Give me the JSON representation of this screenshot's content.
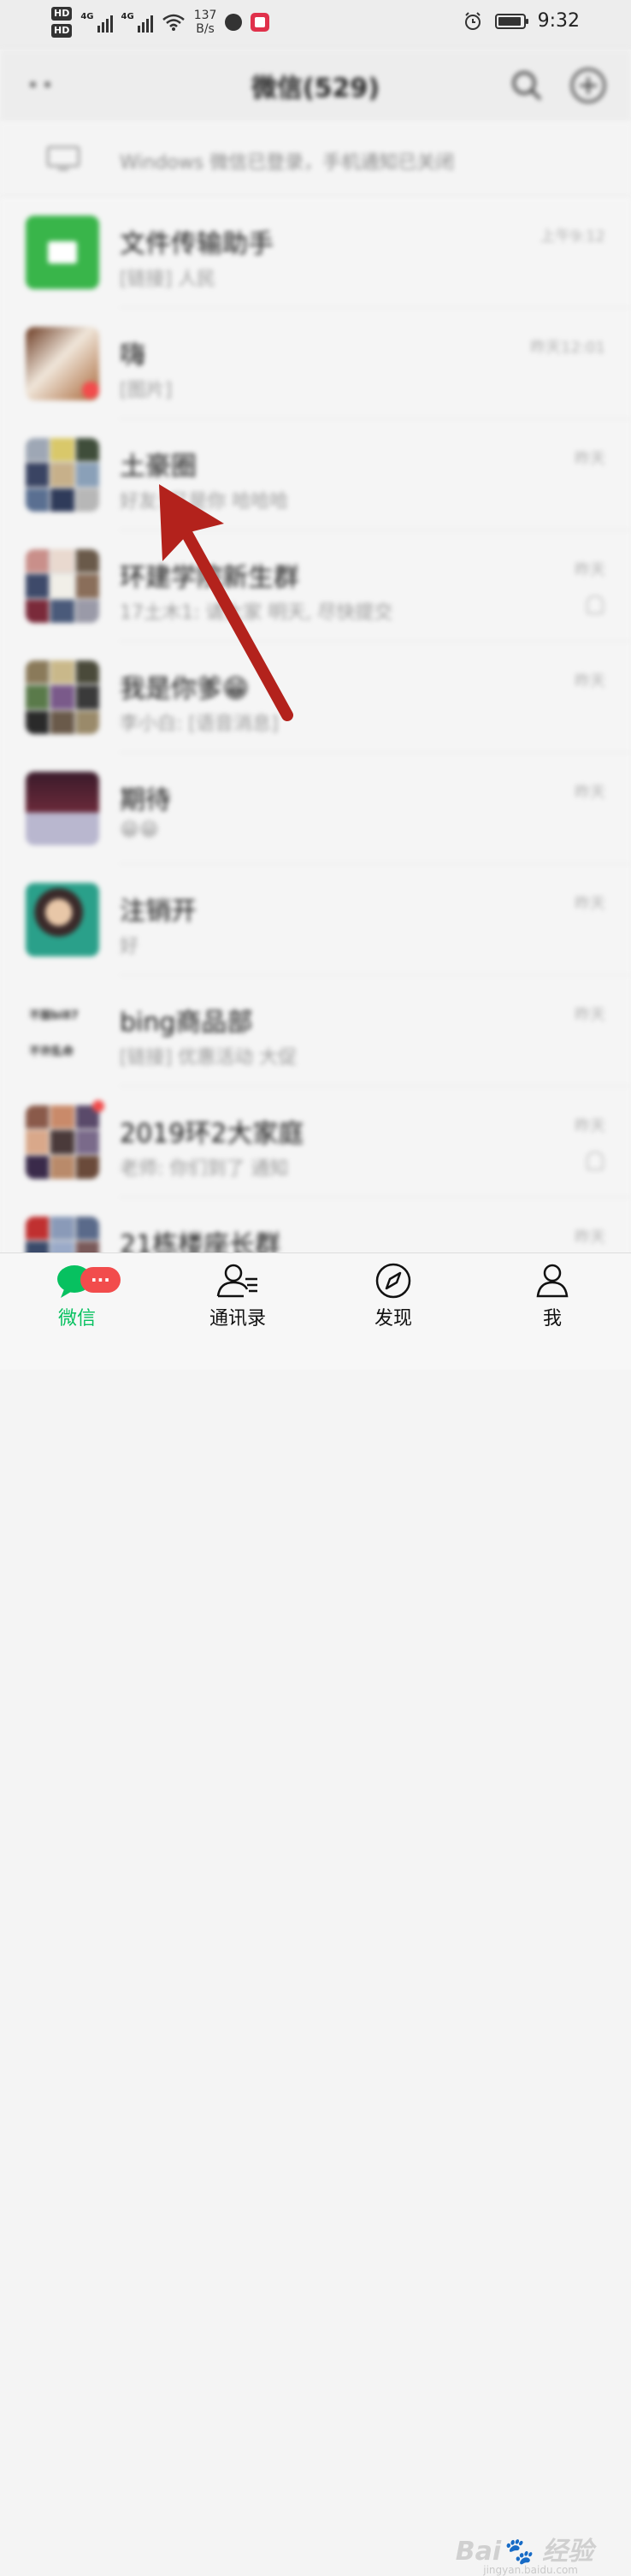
{
  "status_bar": {
    "hd1": "HD",
    "hd2": "HD",
    "signal1": "4G",
    "signal2": "4G",
    "net_speed_value": "137",
    "net_speed_unit": "B/s",
    "time": "9:32"
  },
  "header": {
    "title": "微信(529)",
    "more_label": "••"
  },
  "login_banner": {
    "text": "Windows 微信已登录，手机通知已关闭"
  },
  "chats": [
    {
      "name": "文件传输助手",
      "preview": "[链接] 人民",
      "time": "上午9:12",
      "muted": false
    },
    {
      "name": "嗨",
      "preview": "[图片]",
      "time": "昨天12:01",
      "muted": false
    },
    {
      "name": "土豪圈",
      "preview": "好友: 又是你 哈哈哈",
      "time": "昨天",
      "muted": false
    },
    {
      "name": "环建学院新生群",
      "preview": "17土木1: 请大家 明天, 尽快提交",
      "time": "昨天",
      "muted": true
    },
    {
      "name": "我是你爹😁",
      "preview": "李小白: [语音消息]",
      "time": "昨天",
      "muted": false
    },
    {
      "name": "期待",
      "preview": "😁😁",
      "time": "昨天",
      "muted": false
    },
    {
      "name": "注销开",
      "preview": "好",
      "time": "昨天",
      "muted": false
    },
    {
      "name": "bing商品部",
      "preview": "[链接] 优惠活动 大促",
      "time": "昨天",
      "muted": false
    },
    {
      "name": "2019环2大家庭",
      "preview": "老师: 你们到了 通知",
      "time": "昨天",
      "muted": true
    },
    {
      "name": "21栋楼座长群",
      "preview": "",
      "time": "昨天",
      "muted": false
    }
  ],
  "text_avatar": {
    "line1": "不服bi87",
    "line2": "不许乱命"
  },
  "tabs": [
    {
      "label": "微信",
      "badge": "···"
    },
    {
      "label": "通讯录"
    },
    {
      "label": "发现"
    },
    {
      "label": "我"
    }
  ],
  "watermark": {
    "main": "Bai🐾 经验",
    "sub": "jingyan.baidu.com"
  },
  "colors": {
    "accent_green": "#07c160",
    "badge_red": "#f24c4c",
    "arrow_red": "#b3221c"
  }
}
